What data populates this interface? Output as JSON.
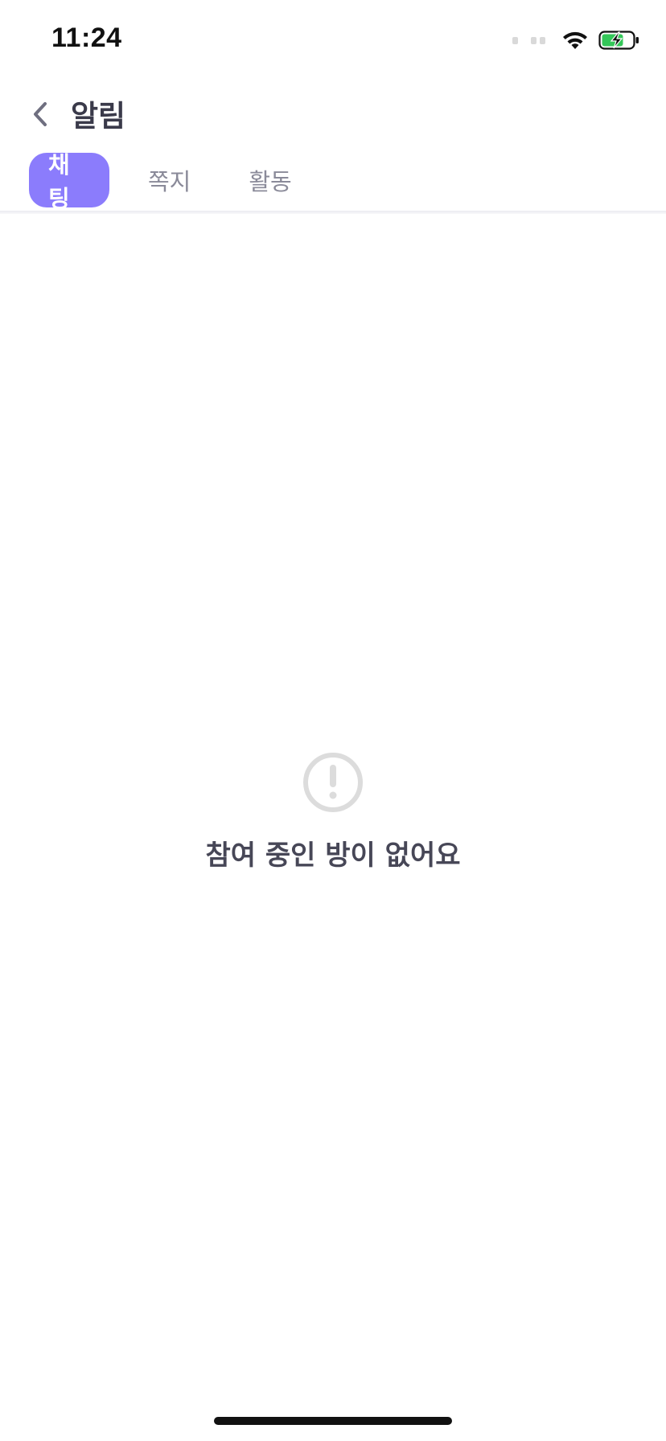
{
  "status_bar": {
    "time": "11:24",
    "icons": [
      "cellular-signal-icon",
      "wifi-icon",
      "battery-charging-icon"
    ]
  },
  "header": {
    "back_icon": "chevron-left-icon",
    "title": "알림"
  },
  "tabs": [
    {
      "label": "채팅",
      "active": true
    },
    {
      "label": "쪽지",
      "active": false
    },
    {
      "label": "활동",
      "active": false
    }
  ],
  "empty_state": {
    "icon": "exclamation-circle-icon",
    "message": "참여 중인 방이 없어요"
  },
  "colors": {
    "accent": "#8b7cfc",
    "title_text": "#3a3a4a",
    "inactive_tab_text": "#8a8a99",
    "empty_icon": "#dcdcdc",
    "battery_charge": "#34c759"
  }
}
